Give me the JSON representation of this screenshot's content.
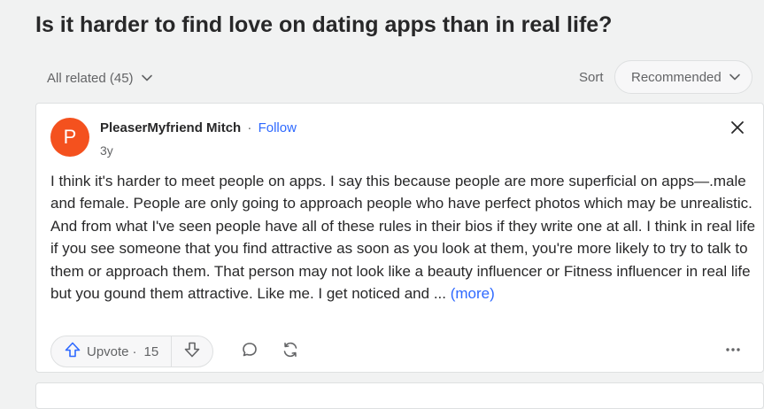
{
  "question": {
    "title": "Is it harder to find love on dating apps than in real life?"
  },
  "filters": {
    "all_related": "All related (45)",
    "sort_label": "Sort",
    "sort_value": "Recommended"
  },
  "answer": {
    "avatar_letter": "P",
    "avatar_color": "#f4511e",
    "author": "PleaserMyfriend Mitch",
    "separator": "·",
    "follow": "Follow",
    "time": "3y",
    "text": "I think it's harder to meet people on apps. I say this because people are more superficial on apps—.male and female. People are only going to approach people who have perfect photos which may be unrealistic. And from what I've seen people have all of these rules in their bios if they write one at all. I think in real life if you see someone that you find attractive as soon as you look at them, you're more likely to try to talk to them or approach them. That person may not look like a beauty influencer or Fitness influencer in real life but you gound them attractive. Like me. I get noticed and ... ",
    "more": "(more)"
  },
  "actions": {
    "upvote_label": "Upvote",
    "upvote_separator": "·",
    "upvote_count": "15",
    "icons": [
      "upvote-arrow-icon",
      "downvote-arrow-icon",
      "comment-icon",
      "share-icon",
      "more-options-icon",
      "close-icon",
      "chevron-down-icon"
    ]
  },
  "colors": {
    "accent": "#2e69ff",
    "page_bg": "#f1f2f2",
    "card_bg": "#ffffff"
  }
}
